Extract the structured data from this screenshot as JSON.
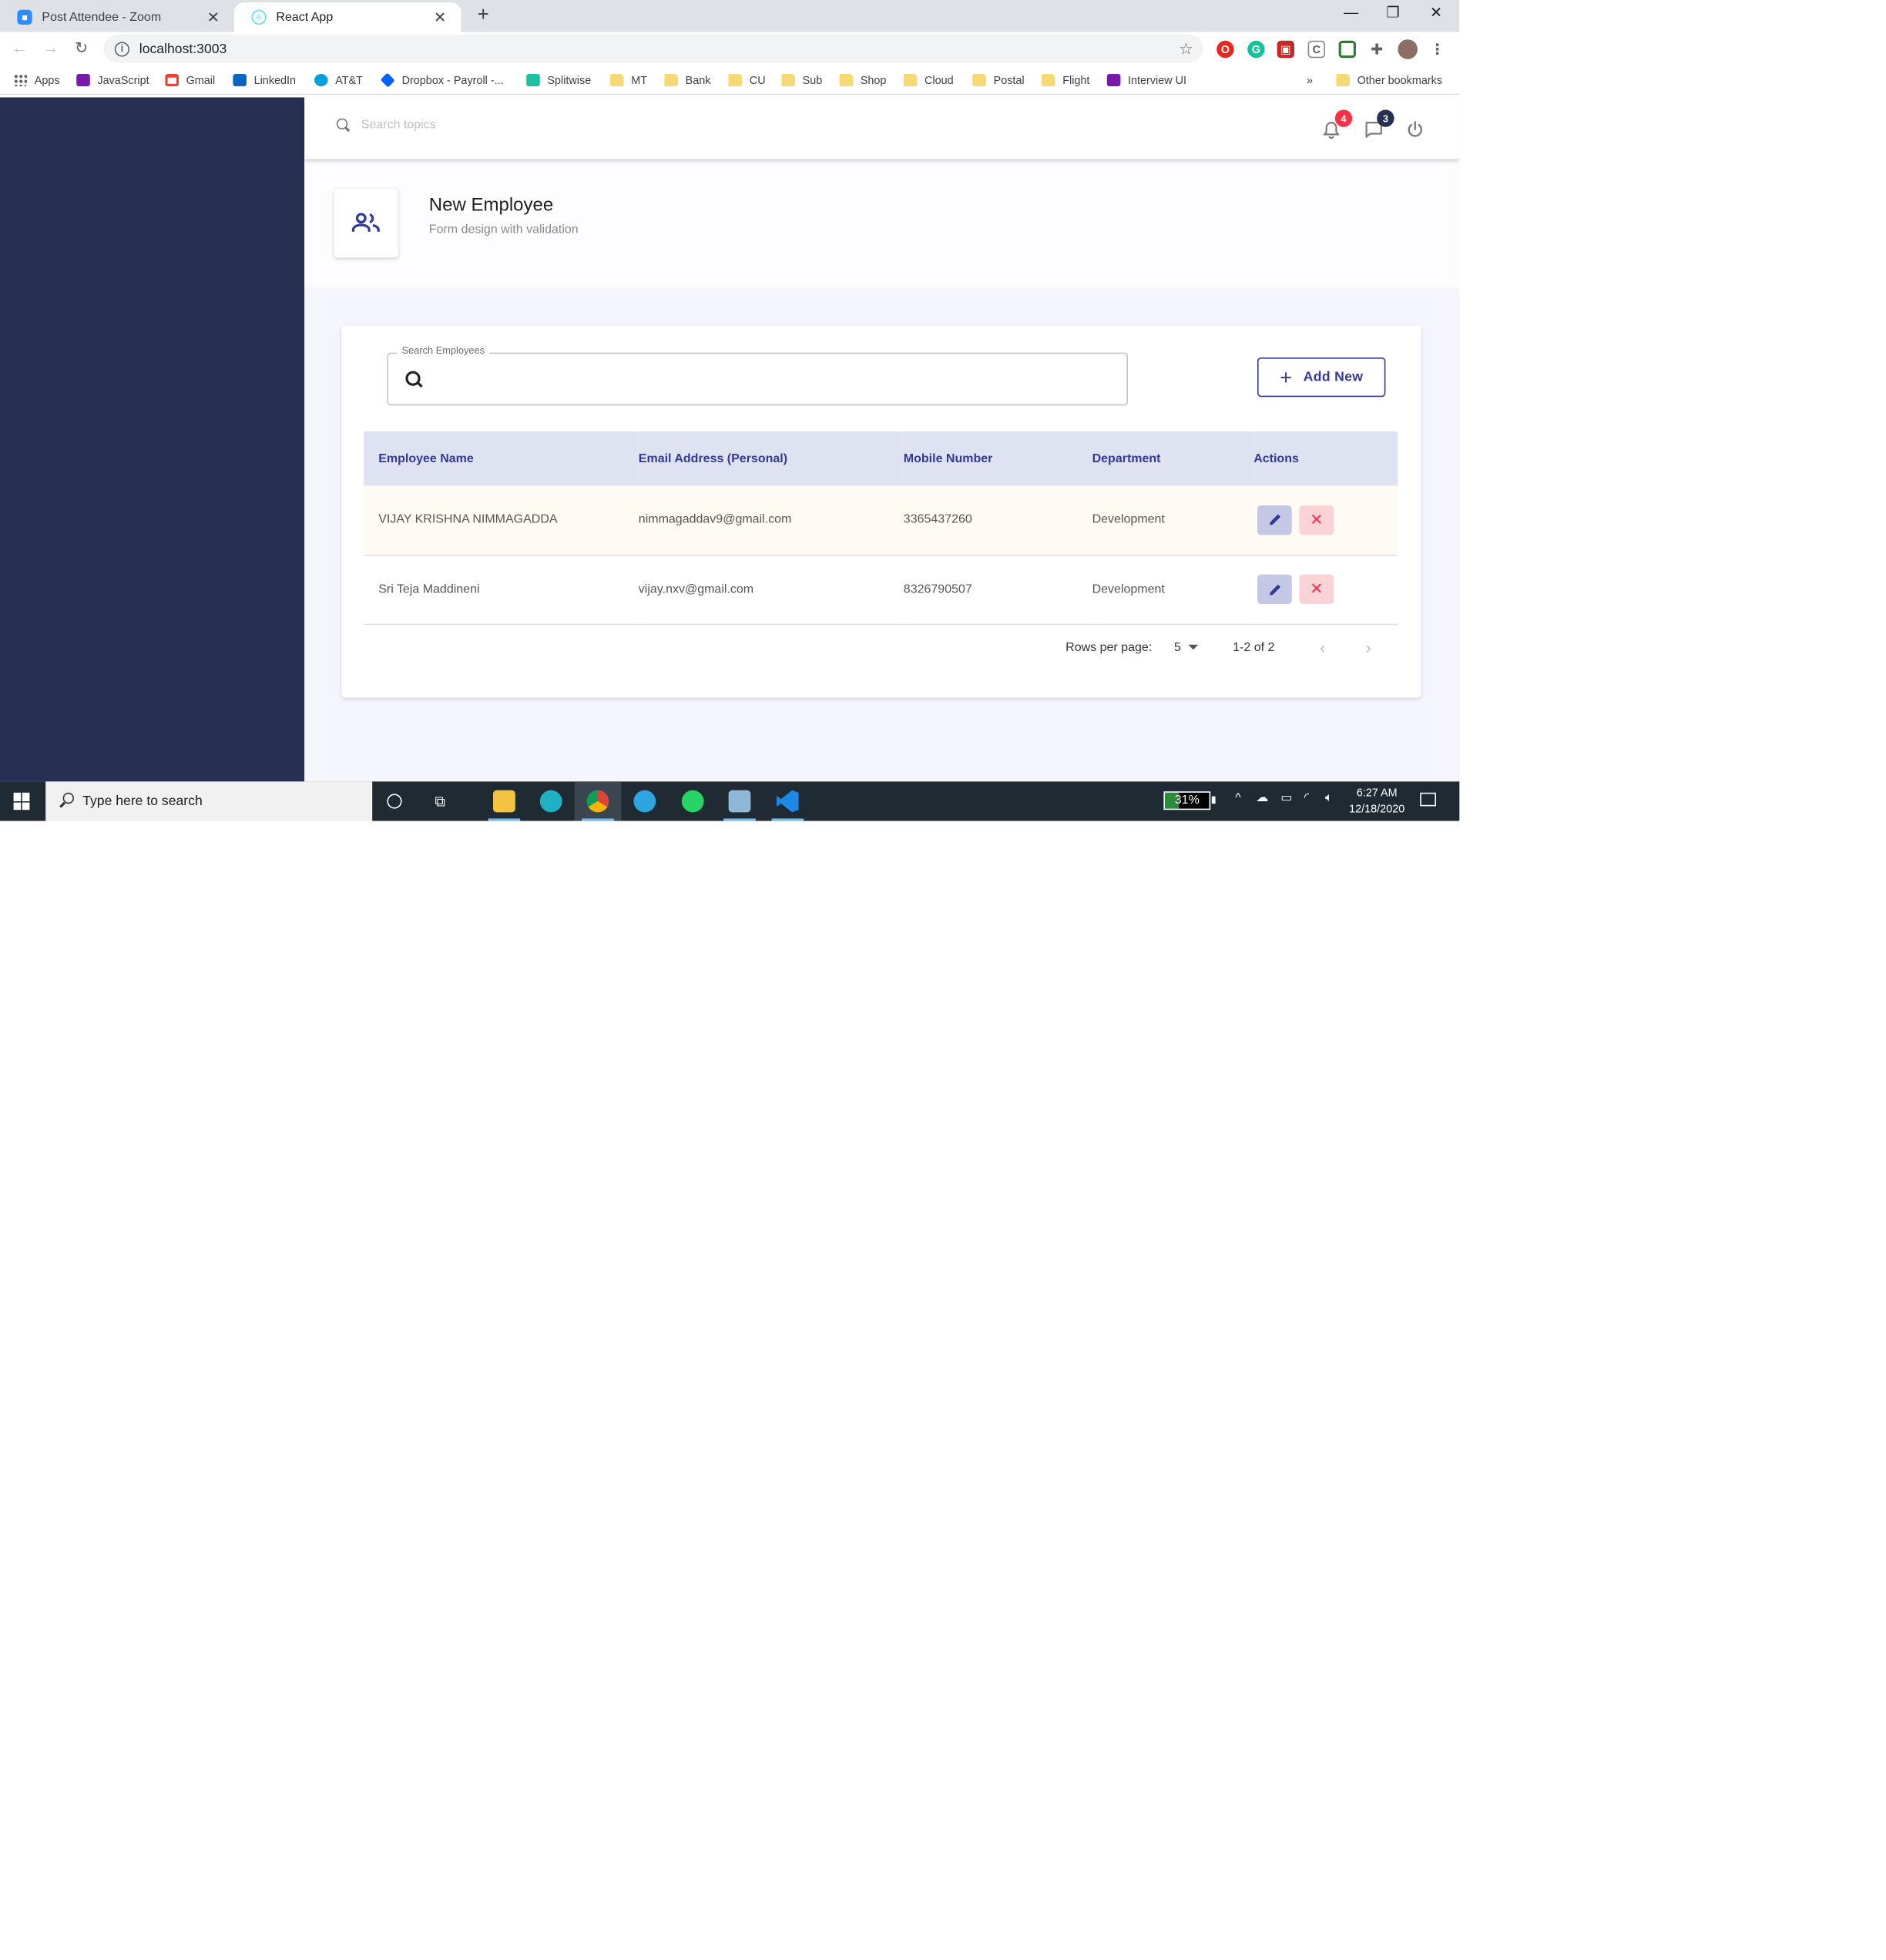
{
  "browser": {
    "tabs": [
      {
        "title": "Post Attendee - Zoom",
        "icon": "zoom-icon",
        "active": false
      },
      {
        "title": "React App",
        "icon": "react-icon",
        "active": true
      }
    ],
    "address": "localhost:3003",
    "bookmarks": [
      {
        "label": "Apps",
        "icon": "apps-grid-icon"
      },
      {
        "label": "JavaScript",
        "icon": "onenote-icon"
      },
      {
        "label": "Gmail",
        "icon": "gmail-icon"
      },
      {
        "label": "LinkedIn",
        "icon": "linkedin-icon"
      },
      {
        "label": "AT&T",
        "icon": "att-icon"
      },
      {
        "label": "Dropbox - Payroll -...",
        "icon": "dropbox-icon"
      },
      {
        "label": "Splitwise",
        "icon": "splitwise-icon"
      },
      {
        "label": "MT",
        "icon": "folder-icon"
      },
      {
        "label": "Bank",
        "icon": "folder-icon"
      },
      {
        "label": "CU",
        "icon": "folder-icon"
      },
      {
        "label": "Sub",
        "icon": "folder-icon"
      },
      {
        "label": "Shop",
        "icon": "folder-icon"
      },
      {
        "label": "Cloud",
        "icon": "folder-icon"
      },
      {
        "label": "Postal",
        "icon": "folder-icon"
      },
      {
        "label": "Flight",
        "icon": "folder-icon"
      },
      {
        "label": "Interview UI",
        "icon": "onenote-icon"
      }
    ],
    "overflow": "»",
    "other_bookmarks": "Other bookmarks"
  },
  "app": {
    "header": {
      "search_placeholder": "Search topics",
      "notifications_count": "4",
      "messages_count": "3"
    },
    "page_header": {
      "title": "New Employee",
      "subtitle": "Form design with validation",
      "icon": "people-outline-icon"
    },
    "employees": {
      "search_label": "Search Employees",
      "search_value": "",
      "add_new_label": "Add New",
      "columns": [
        "Employee Name",
        "Email Address (Personal)",
        "Mobile Number",
        "Department",
        "Actions"
      ],
      "rows": [
        {
          "name": "VIJAY KRISHNA NIMMAGADDA",
          "email": "nimmagaddav9@gmail.com",
          "mobile": "3365437260",
          "department": "Development"
        },
        {
          "name": "Sri Teja Maddineni",
          "email": "vijay.nxv@gmail.com",
          "mobile": "8326790507",
          "department": "Development"
        }
      ],
      "pagination": {
        "rows_per_page_label": "Rows per page:",
        "rows_per_page": "5",
        "range": "1-2 of 2"
      }
    },
    "colors": {
      "sidebar": "#253053",
      "primary": "#333996",
      "secondary": "#f83245",
      "table_head": "#dfe2f1",
      "background": "#f4f5fd"
    }
  },
  "taskbar": {
    "search_placeholder": "Type here to search",
    "battery": "31%",
    "time": "6:27 AM",
    "date": "12/18/2020"
  }
}
